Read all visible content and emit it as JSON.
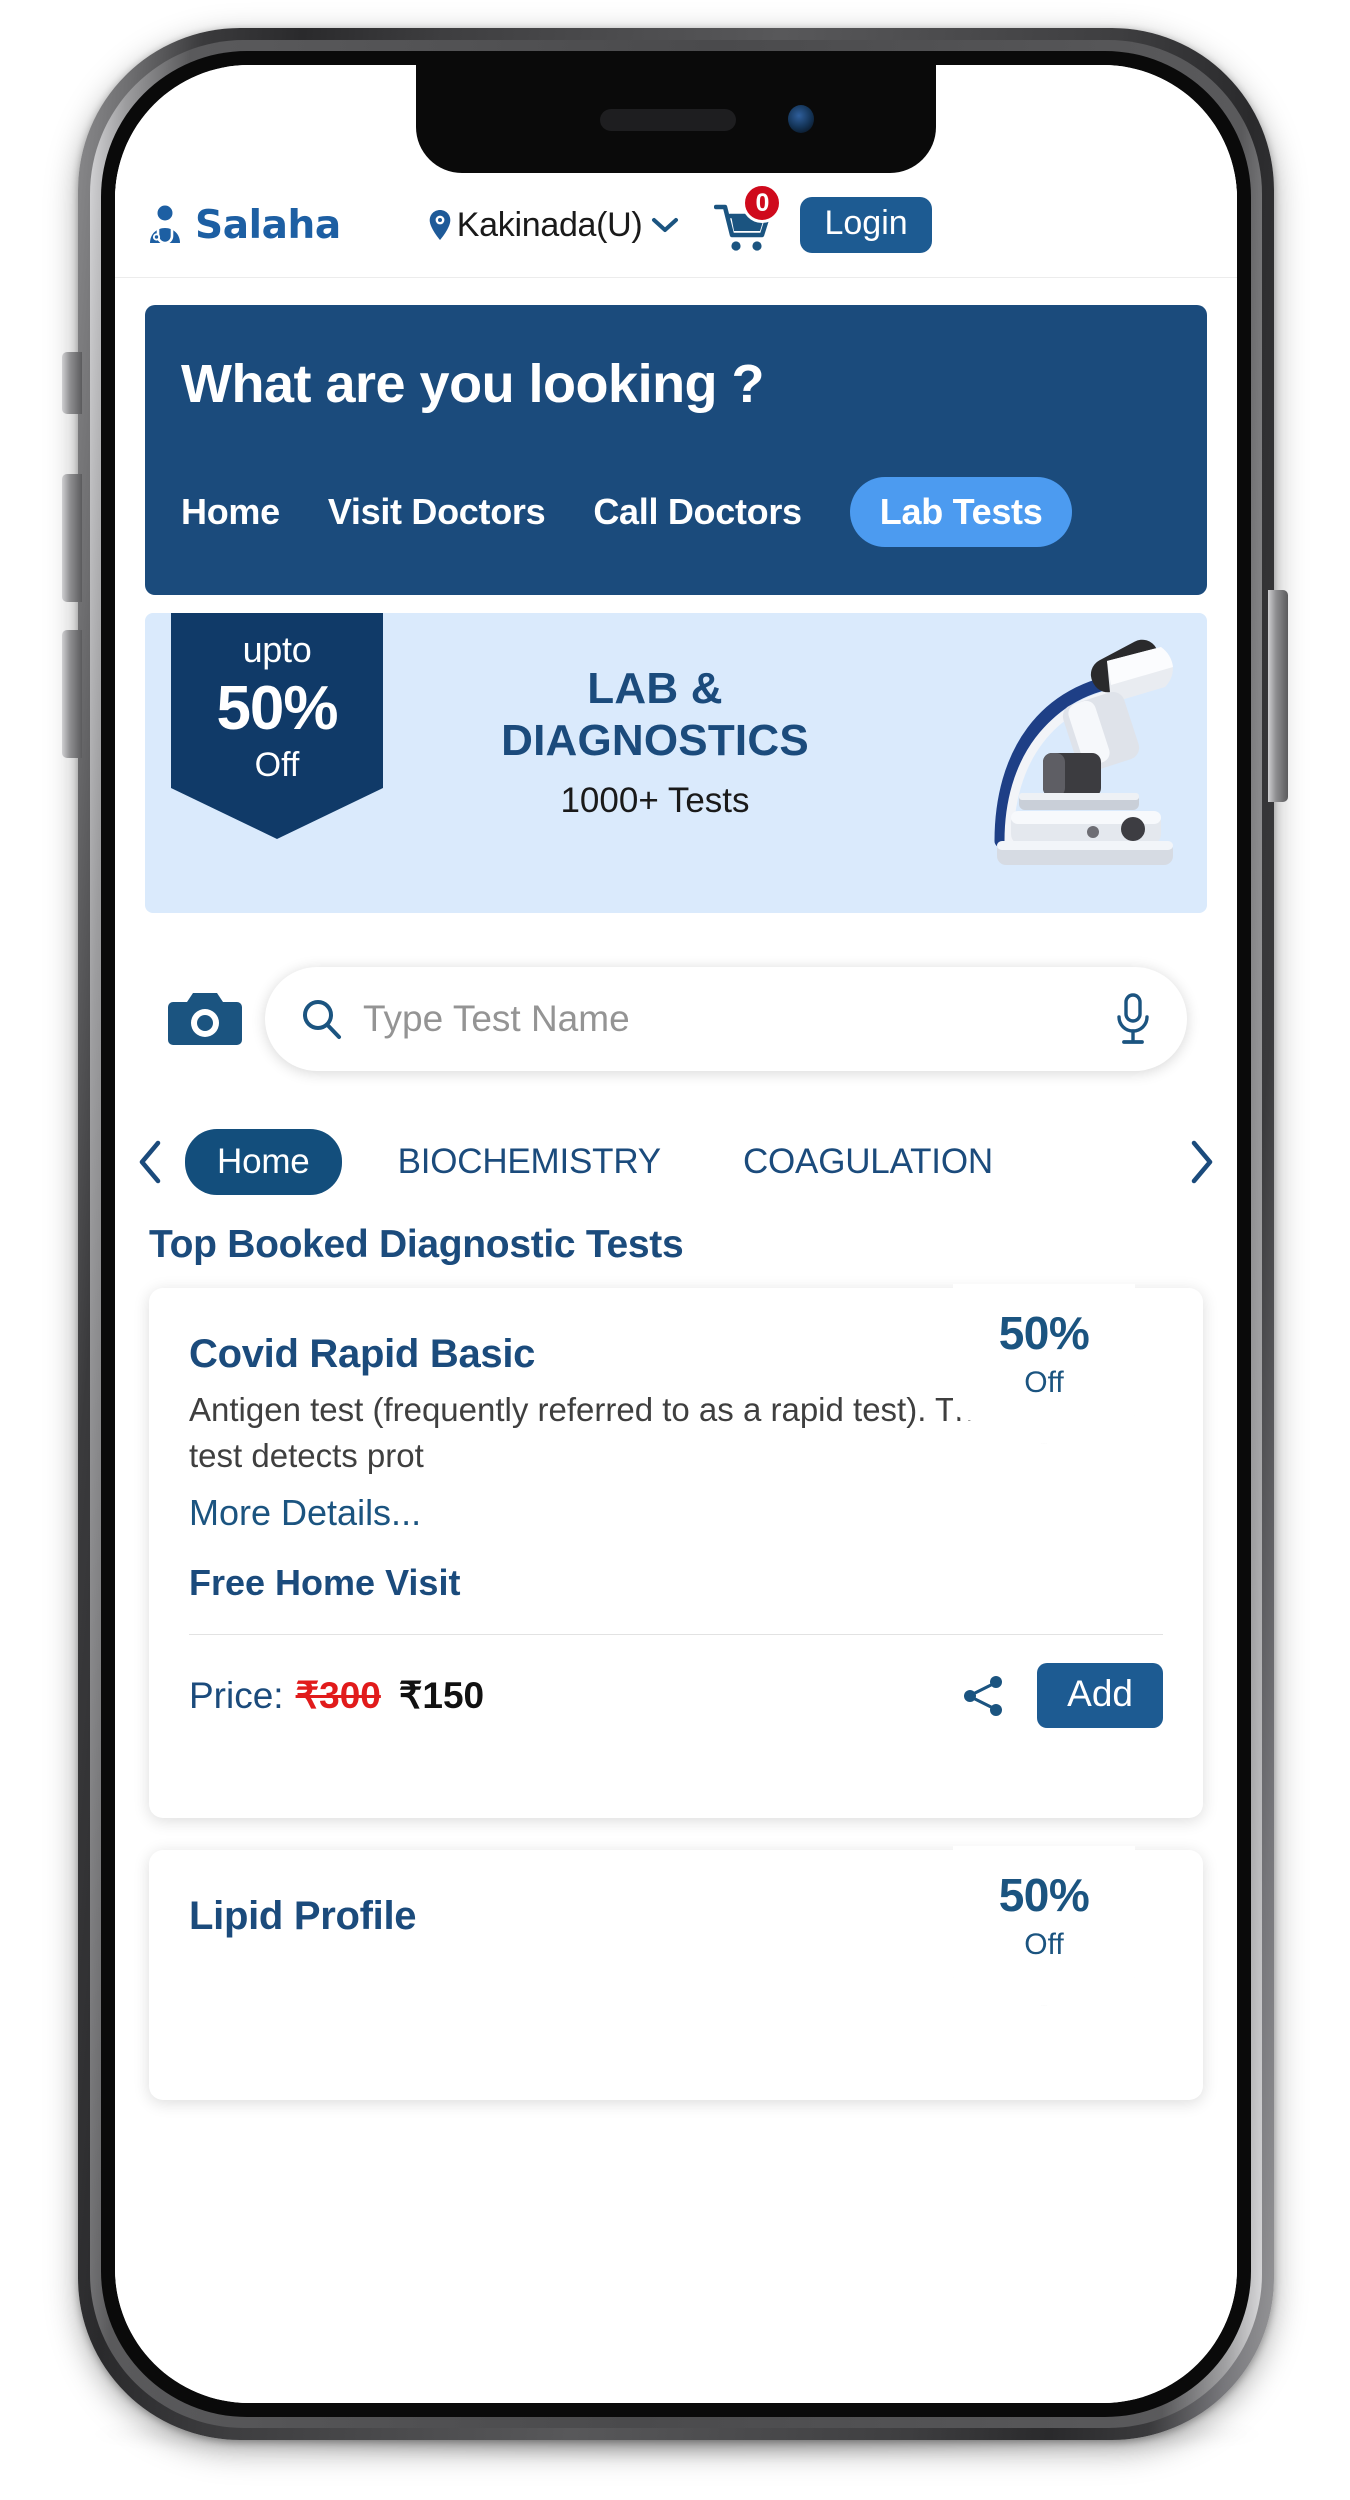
{
  "header": {
    "brand_name": "Salaha",
    "brand_icon": "doctor-avatar-icon",
    "location_icon": "map-pin-icon",
    "location": "Kakinada(U)",
    "location_chevron": "chevron-down-icon",
    "cart_icon": "shopping-cart-icon",
    "cart_count": "0",
    "login_label": "Login"
  },
  "hero": {
    "title": "What are you looking ?",
    "tabs": [
      {
        "label": "Home",
        "active": false
      },
      {
        "label": "Visit Doctors",
        "active": false
      },
      {
        "label": "Call Doctors",
        "active": false
      },
      {
        "label": "Lab Tests",
        "active": true
      }
    ],
    "bg_color": "#1b4b7c",
    "active_tab_color": "#4c9bf0"
  },
  "promo": {
    "ribbon_upto": "upto",
    "ribbon_percent": "50%",
    "ribbon_off": "Off",
    "line1": "LAB &",
    "line2": "DIAGNOSTICS",
    "line3": "1000+ Tests",
    "image_icon": "microscope-image",
    "bg_color": "#daeafc",
    "ribbon_color": "#103a68"
  },
  "search": {
    "camera_icon": "camera-icon",
    "search_icon": "search-icon",
    "placeholder": "Type Test Name",
    "value": "",
    "mic_icon": "microphone-icon"
  },
  "categories": {
    "prev_icon": "chevron-left-icon",
    "next_icon": "chevron-right-icon",
    "items": [
      {
        "label": "Home",
        "active": true
      },
      {
        "label": "BIOCHEMISTRY",
        "active": false
      },
      {
        "label": "COAGULATION",
        "active": false
      }
    ]
  },
  "section": {
    "title": "Top Booked Diagnostic Tests"
  },
  "tests": [
    {
      "name": "Covid Rapid Basic",
      "description": "Antigen test (frequently referred to as a rapid test). This test detects prot",
      "more_details": "More Details...",
      "home_visit": "Free Home Visit",
      "discount_percent": "50%",
      "discount_off": "Off",
      "price_label": "Price:",
      "price_old": "₹300",
      "price_new": "₹150",
      "share_icon": "share-icon",
      "add_label": "Add"
    },
    {
      "name": "Lipid Profile",
      "discount_percent": "50%",
      "discount_off": "Off"
    }
  ],
  "colors": {
    "brand_blue": "#1d5fa3",
    "navy": "#1b4b7c",
    "deep_navy": "#103a68",
    "light_blue": "#daeafc",
    "accent_blue": "#4c9bf0",
    "button_blue": "#1d5b92",
    "badge_red": "#cf0a1c",
    "strike_red": "#e11b1b"
  }
}
